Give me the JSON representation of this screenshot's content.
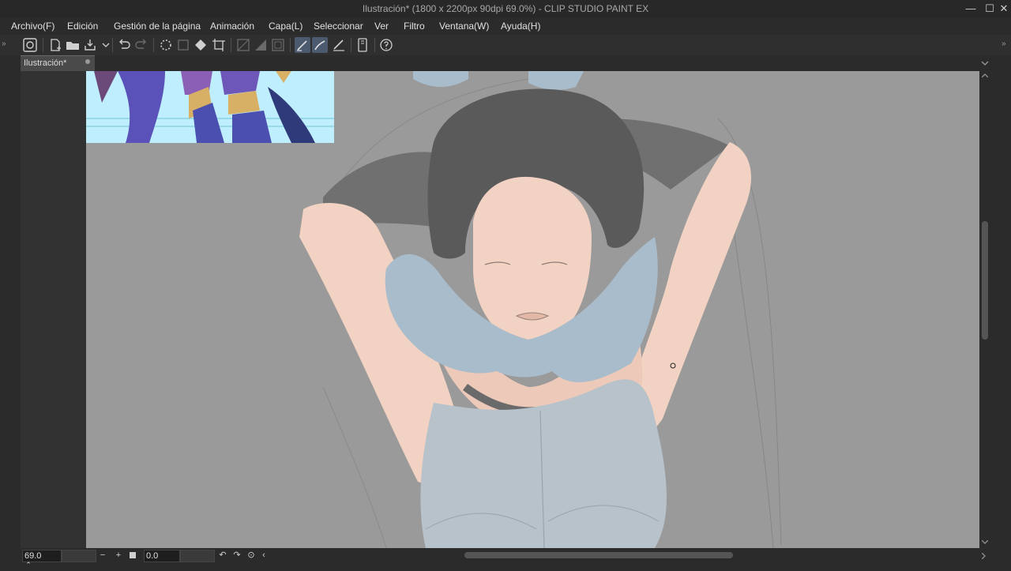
{
  "window": {
    "title": "Ilustración* (1800 x 2200px 90dpi 69.0%)  - CLIP STUDIO PAINT EX",
    "minimize": "—",
    "maximize": "☐",
    "close": "✕"
  },
  "menu": [
    "Archivo(F)",
    "Edición",
    "Gestión de la página",
    "Animación",
    "Capa(L)",
    "Seleccionar",
    "Ver",
    "Filtro",
    "Ventana(W)",
    "Ayuda(H)"
  ],
  "toolbar": {
    "icons": [
      "clip-studio-icon",
      "new-icon",
      "open-icon",
      "save-icon",
      "dropdown-icon",
      "undo-icon",
      "redo-icon",
      "loading-icon",
      "clear-icon",
      "fill-icon",
      "transform-icon",
      "tone-icon",
      "gradient-icon",
      "border-icon",
      "pen-icon",
      "brush-icon",
      "eraser-icon",
      "device-icon",
      "help-icon"
    ]
  },
  "tab": {
    "label": "Ilustración*"
  },
  "status": {
    "zoom": "69.0",
    "rotation": "0.0",
    "zoom_out": "−",
    "zoom_in": "+",
    "rotate_left": "↶",
    "rotate_right": "↷",
    "reset": "⊙",
    "scroll_left": "‹",
    "chevron": "»",
    "collapse": "⌃"
  },
  "colors": {
    "canvas": "#9a9a9a",
    "skin": "#f2d2c2",
    "fur": "#a9bccb",
    "hair": "#5a5a5a",
    "accent": "#4c5a70"
  }
}
